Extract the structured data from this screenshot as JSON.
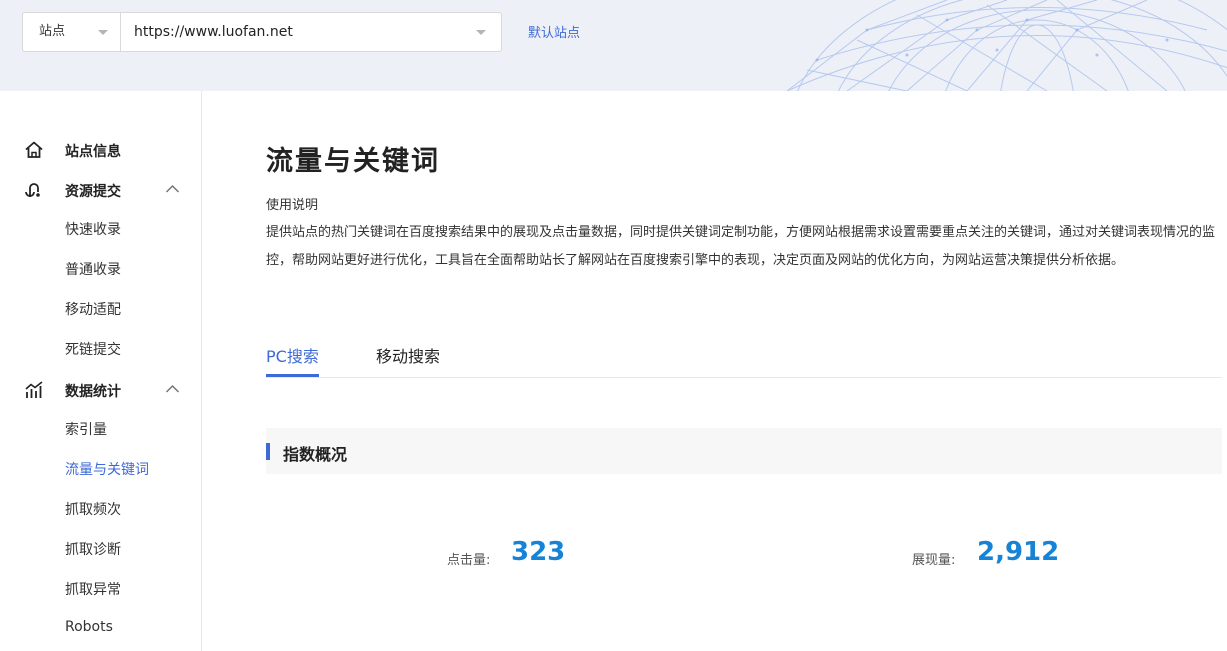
{
  "header": {
    "site_type": "站点",
    "site_url": "https://www.luofan.net",
    "default_site_link": "默认站点"
  },
  "sidebar": {
    "groups": [
      {
        "label": "站点信息",
        "icon": "home-icon"
      },
      {
        "label": "资源提交",
        "icon": "submit-icon",
        "expanded": true,
        "items": [
          "快速收录",
          "普通收录",
          "移动适配",
          "死链提交"
        ]
      },
      {
        "label": "数据统计",
        "icon": "stats-icon",
        "expanded": true,
        "items": [
          "索引量",
          "流量与关键词",
          "抓取频次",
          "抓取诊断",
          "抓取异常",
          "Robots"
        ]
      }
    ],
    "active_item": "流量与关键词"
  },
  "main": {
    "title": "流量与关键词",
    "usage_title": "使用说明",
    "description": "提供站点的热门关键词在百度搜索结果中的展现及点击量数据，同时提供关键词定制功能，方便网站根据需求设置需要重点关注的关键词，通过对关键词表现情况的监控，帮助网站更好进行优化，工具旨在全面帮助站长了解网站在百度搜索引擎中的表现，决定页面及网站的优化方向，为网站运营决策提供分析依据。",
    "tabs": [
      {
        "label": "PC搜索",
        "active": true
      },
      {
        "label": "移动搜索",
        "active": false
      }
    ],
    "section_title": "指数概况",
    "metrics": {
      "clicks_label": "点击量:",
      "clicks_value": "323",
      "views_label": "展现量:",
      "views_value": "2,912"
    }
  },
  "colors": {
    "accent": "#3d6ad6",
    "metric_value": "#1783d7",
    "header_bg": "#eef0f8"
  }
}
